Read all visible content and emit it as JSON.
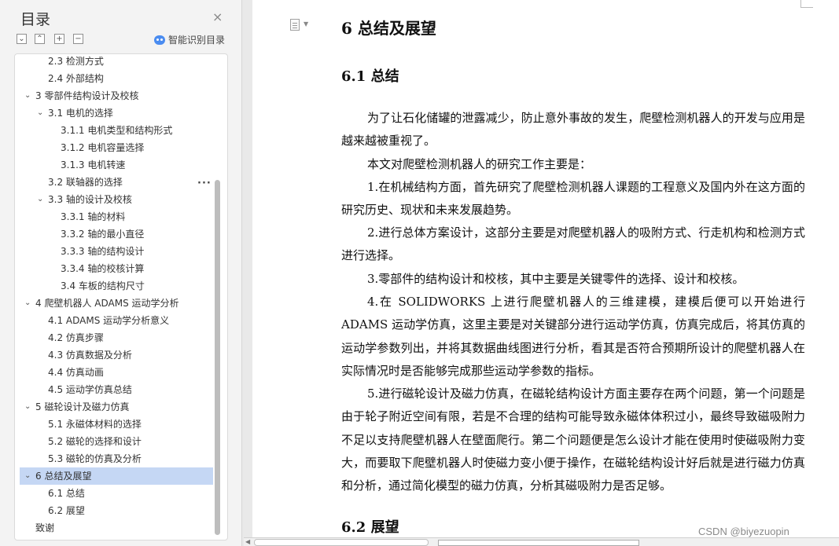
{
  "toc": {
    "title": "目录",
    "close": "×",
    "tools": [
      "⌄",
      "⌃",
      "+",
      "−"
    ],
    "smart_toc_label": "智能识别目录",
    "more": "···",
    "items": [
      {
        "label": "2.3 检测方式",
        "level": 2,
        "caret": ""
      },
      {
        "label": "2.4 外部结构",
        "level": 2,
        "caret": ""
      },
      {
        "label": "3 零部件结构设计及校核",
        "level": 1,
        "caret": "⌄"
      },
      {
        "label": "3.1 电机的选择",
        "level": 2,
        "caret": "⌄"
      },
      {
        "label": "3.1.1 电机类型和结构形式",
        "level": 3,
        "caret": ""
      },
      {
        "label": "3.1.2 电机容量选择",
        "level": 3,
        "caret": ""
      },
      {
        "label": "3.1.3 电机转速",
        "level": 3,
        "caret": ""
      },
      {
        "label": "3.2 联轴器的选择",
        "level": 2,
        "caret": ""
      },
      {
        "label": "3.3 轴的设计及校核",
        "level": 2,
        "caret": "⌄"
      },
      {
        "label": "3.3.1 轴的材料",
        "level": 3,
        "caret": ""
      },
      {
        "label": "3.3.2 轴的最小直径",
        "level": 3,
        "caret": ""
      },
      {
        "label": "3.3.3 轴的结构设计",
        "level": 3,
        "caret": ""
      },
      {
        "label": "3.3.4 轴的校核计算",
        "level": 3,
        "caret": ""
      },
      {
        "label": "3.4 车板的结构尺寸",
        "level": 3,
        "caret": ""
      },
      {
        "label": "4  爬壁机器人 ADAMS 运动学分析",
        "level": 1,
        "caret": "⌄"
      },
      {
        "label": "4.1 ADAMS 运动学分析意义",
        "level": 2,
        "caret": ""
      },
      {
        "label": "4.2 仿真步骤",
        "level": 2,
        "caret": ""
      },
      {
        "label": "4.3 仿真数据及分析",
        "level": 2,
        "caret": ""
      },
      {
        "label": "4.4 仿真动画",
        "level": 2,
        "caret": ""
      },
      {
        "label": "4.5 运动学仿真总结",
        "level": 2,
        "caret": ""
      },
      {
        "label": "5  磁轮设计及磁力仿真",
        "level": 1,
        "caret": "⌄"
      },
      {
        "label": "5.1 永磁体材料的选择",
        "level": 2,
        "caret": ""
      },
      {
        "label": "5.2 磁轮的选择和设计",
        "level": 2,
        "caret": ""
      },
      {
        "label": "5.3 磁轮的仿真及分析",
        "level": 2,
        "caret": ""
      },
      {
        "label": "6  总结及展望",
        "level": 1,
        "caret": "⌄",
        "active": true
      },
      {
        "label": "6.1 总结",
        "level": 2,
        "caret": ""
      },
      {
        "label": "6.2 展望",
        "level": 2,
        "caret": ""
      },
      {
        "label": "致谢",
        "level": 0,
        "caret": ""
      }
    ]
  },
  "document": {
    "h1": "6  总结及展望",
    "h2_1": "6.1 总结",
    "paragraphs": [
      "为了让石化储罐的泄露减少，防止意外事故的发生，爬壁检测机器人的开发与应用是越来越被重视了。",
      "本文对爬壁检测机器人的研究工作主要是：",
      "1.在机械结构方面，首先研究了爬壁检测机器人课题的工程意义及国内外在这方面的研究历史、现状和未来发展趋势。",
      "2.进行总体方案设计，这部分主要是对爬壁机器人的吸附方式、行走机构和检测方式进行选择。",
      "3.零部件的结构设计和校核，其中主要是关键零件的选择、设计和校核。",
      "4.在 SOLIDWORKS 上进行爬壁机器人的三维建模，建模后便可以开始进行 ADAMS 运动学仿真，这里主要是对关键部分进行运动学仿真，仿真完成后，将其仿真的运动学参数列出，并将其数据曲线图进行分析，看其是否符合预期所设计的爬壁机器人在实际情况时是否能够完成那些运动学参数的指标。",
      "5.进行磁轮设计及磁力仿真，在磁轮结构设计方面主要存在两个问题，第一个问题是由于轮子附近空间有限，若是不合理的结构可能导致永磁体体积过小，最终导致磁吸附力不足以支持爬壁机器人在壁面爬行。第二个问题便是怎么设计才能在使用时使磁吸附力变大，而要取下爬壁机器人时使磁力变小便于操作，在磁轮结构设计好后就是进行磁力仿真和分析，通过简化模型的磁力仿真，分析其磁吸附力是否足够。"
    ],
    "h2_2": "6.2 展望"
  },
  "watermark": "CSDN @biyezuopin"
}
